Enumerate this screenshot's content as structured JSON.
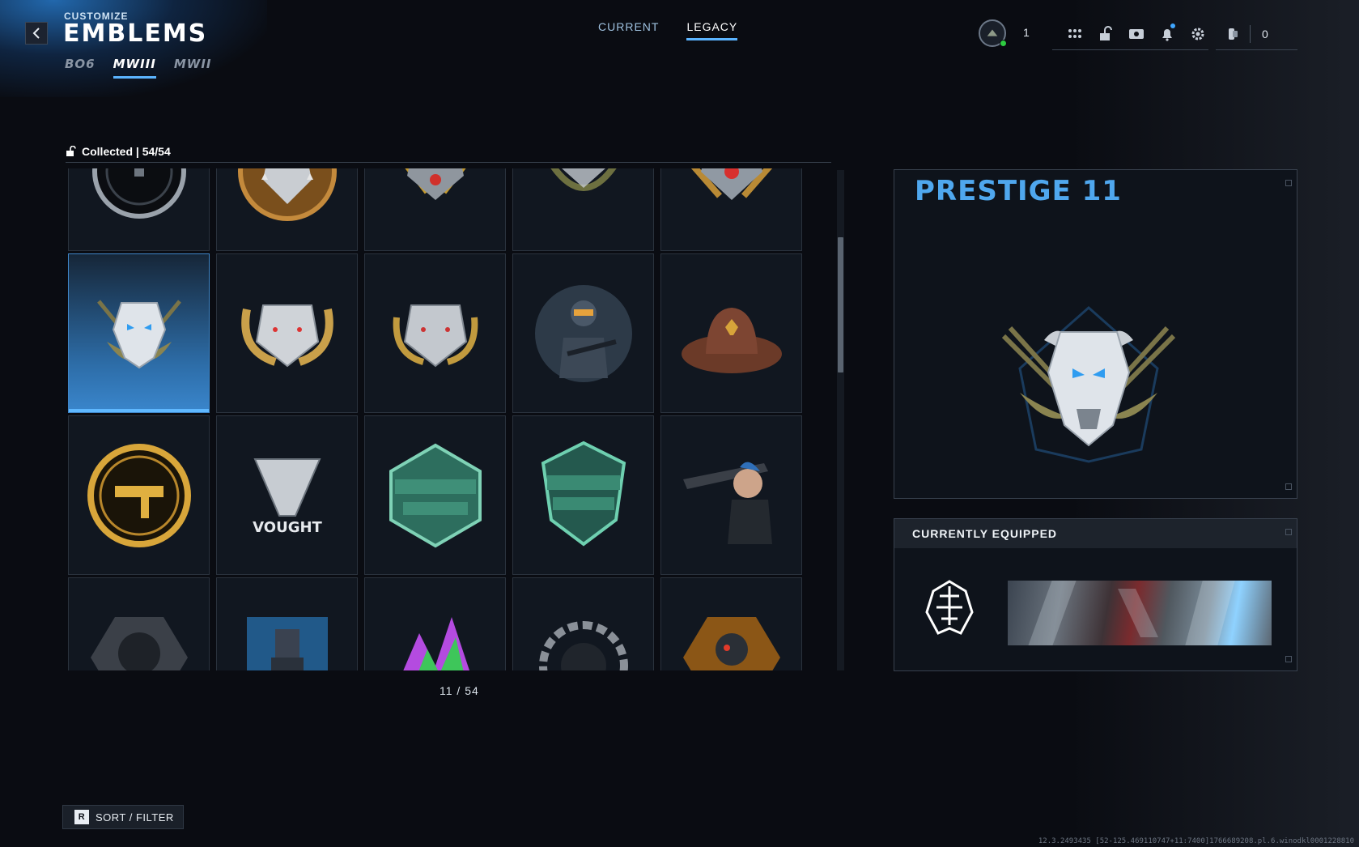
{
  "header": {
    "customize_label": "CUSTOMIZE",
    "title": "EMBLEMS",
    "game_tabs": [
      {
        "label": "BO6",
        "active": false
      },
      {
        "label": "MWIII",
        "active": true
      },
      {
        "label": "MWII",
        "active": false
      }
    ]
  },
  "top_tabs": [
    {
      "label": "CURRENT",
      "active": false
    },
    {
      "label": "LEGACY",
      "active": true
    }
  ],
  "hud": {
    "player_level": "1",
    "currency_value": "0",
    "icons": [
      "grid-icon",
      "unlock-icon",
      "store-icon",
      "bell-icon",
      "gear-icon",
      "currency-icon"
    ],
    "notification": true
  },
  "collection": {
    "label": "Collected | 54/54",
    "page_indicator": "11 / 54",
    "scroll_fraction": 0.27,
    "tiles": [
      {
        "emblem": "dark-ring-emblem"
      },
      {
        "emblem": "bronze-wolf-emblem"
      },
      {
        "emblem": "gold-wolf-emblem"
      },
      {
        "emblem": "laurel-buffalo-emblem"
      },
      {
        "emblem": "red-eye-wolf-emblem"
      },
      {
        "emblem": "prestige-buffalo-emblem",
        "selected": true
      },
      {
        "emblem": "gold-horn-bear-emblem"
      },
      {
        "emblem": "silver-bear-emblem"
      },
      {
        "emblem": "soldier-portrait-emblem"
      },
      {
        "emblem": "sheriff-hat-emblem"
      },
      {
        "emblem": "gold-smg-emblem"
      },
      {
        "emblem": "vought-logo-emblem"
      },
      {
        "emblem": "ranked-season-two-emblem"
      },
      {
        "emblem": "ranked-season-three-emblem"
      },
      {
        "emblem": "sniper-operator-emblem"
      },
      {
        "emblem": "masked-operator-emblem"
      },
      {
        "emblem": "water-tower-emblem"
      },
      {
        "emblem": "neon-splash-emblem"
      },
      {
        "emblem": "gear-skull-emblem"
      },
      {
        "emblem": "orange-operator-emblem"
      }
    ]
  },
  "preview": {
    "title": "PRESTIGE 11"
  },
  "equipped": {
    "header": "CURRENTLY EQUIPPED"
  },
  "footer": {
    "sort_key": "R",
    "sort_label": "SORT / FILTER",
    "build_string": "12.3.2493435 [52-125.469110747+11:7400]1766689208.pl.6.winodkl0001228810"
  },
  "colors": {
    "accent": "#5bb4ff",
    "title_blue": "#4fa7ee",
    "online": "#2ecc40"
  }
}
